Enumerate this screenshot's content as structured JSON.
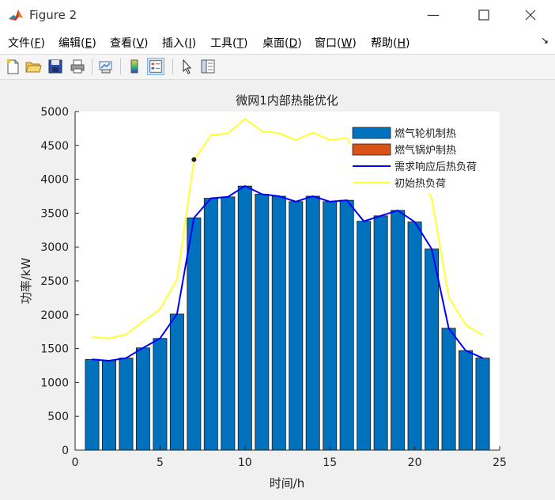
{
  "window": {
    "title": "Figure 2",
    "icon": "matlab-logo-icon",
    "controls": [
      "minimize-icon",
      "maximize-icon",
      "close-icon"
    ]
  },
  "menu": [
    {
      "label": "文件",
      "key": "F"
    },
    {
      "label": "编辑",
      "key": "E"
    },
    {
      "label": "查看",
      "key": "V"
    },
    {
      "label": "插入",
      "key": "I"
    },
    {
      "label": "工具",
      "key": "T"
    },
    {
      "label": "桌面",
      "key": "D"
    },
    {
      "label": "窗口",
      "key": "W"
    },
    {
      "label": "帮助",
      "key": "H"
    }
  ],
  "toolbar": [
    "new-figure-icon",
    "open-icon",
    "save-icon",
    "print-icon",
    "link-plot-icon",
    "colorbar-icon",
    "legend-icon",
    "pointer-icon",
    "property-inspector-icon"
  ],
  "colors": {
    "bar": "#0072bd",
    "bar_edge": "#1a1a1a",
    "boiler": "#d95319",
    "demand_line": "#0000ff",
    "initial_line": "#ffff33"
  },
  "chart_data": {
    "type": "bar",
    "title": "微网1内部热能优化",
    "xlabel": "时间/h",
    "ylabel": "功率/kW",
    "xlim": [
      0,
      25
    ],
    "ylim": [
      0,
      5000
    ],
    "xticks": [
      0,
      5,
      10,
      15,
      20,
      25
    ],
    "yticks": [
      0,
      500,
      1000,
      1500,
      2000,
      2500,
      3000,
      3500,
      4000,
      4500,
      5000
    ],
    "grid": false,
    "legend_position": "top-right",
    "x": [
      1,
      2,
      3,
      4,
      5,
      6,
      7,
      8,
      9,
      10,
      11,
      12,
      13,
      14,
      15,
      16,
      17,
      18,
      19,
      20,
      21,
      22,
      23,
      24
    ],
    "series": [
      {
        "name": "燃气轮机制热",
        "type": "bar",
        "values": [
          1340,
          1320,
          1360,
          1510,
          1650,
          2010,
          3430,
          3720,
          3740,
          3900,
          3780,
          3750,
          3670,
          3750,
          3670,
          3690,
          3380,
          3460,
          3540,
          3370,
          2970,
          1800,
          1470,
          1360
        ]
      },
      {
        "name": "燃气锅炉制热",
        "type": "bar",
        "values": [
          0,
          0,
          0,
          0,
          0,
          0,
          0,
          0,
          0,
          0,
          0,
          0,
          0,
          0,
          0,
          0,
          0,
          0,
          0,
          0,
          0,
          0,
          0,
          0
        ]
      },
      {
        "name": "需求响应后热负荷",
        "type": "line",
        "values": [
          1340,
          1320,
          1360,
          1510,
          1650,
          2010,
          3430,
          3720,
          3740,
          3900,
          3780,
          3750,
          3670,
          3750,
          3670,
          3690,
          3380,
          3460,
          3540,
          3370,
          2970,
          1800,
          1470,
          1360
        ]
      },
      {
        "name": "初始热负荷",
        "type": "line",
        "values": [
          1670,
          1650,
          1710,
          1900,
          2080,
          2520,
          4280,
          4650,
          4680,
          4890,
          4710,
          4680,
          4580,
          4690,
          4580,
          4610,
          4230,
          4330,
          4420,
          4210,
          3720,
          2260,
          1850,
          1700
        ]
      }
    ],
    "annotation_point": {
      "x": 7,
      "y": 4290
    }
  }
}
